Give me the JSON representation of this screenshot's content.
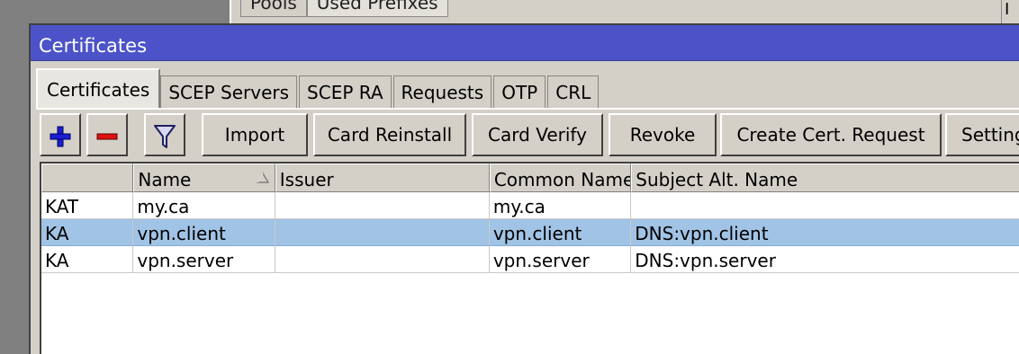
{
  "background_window": {
    "tabs": [
      "Pools",
      "Used Prefixes"
    ],
    "scroll_label": "I"
  },
  "window": {
    "title": "Certificates",
    "accent_color": "#4c53c8"
  },
  "tabs": [
    "Certificates",
    "SCEP Servers",
    "SCEP RA",
    "Requests",
    "OTP",
    "CRL"
  ],
  "toolbar": {
    "add_icon": "plus-icon",
    "remove_icon": "minus-icon",
    "filter_icon": "filter-icon",
    "buttons": [
      "Import",
      "Card Reinstall",
      "Card Verify",
      "Revoke",
      "Create Cert. Request",
      "Settings"
    ]
  },
  "table": {
    "columns": [
      "",
      "Name",
      "Issuer",
      "Common Name",
      "Subject Alt. Name"
    ],
    "rows": [
      {
        "flags": "KAT",
        "name": "my.ca",
        "issuer": "",
        "common_name": "my.ca",
        "subject_alt_name": ""
      },
      {
        "flags": "KA",
        "name": "vpn.client",
        "issuer": "",
        "common_name": "vpn.client",
        "subject_alt_name": "DNS:vpn.client"
      },
      {
        "flags": "KA",
        "name": "vpn.server",
        "issuer": "",
        "common_name": "vpn.server",
        "subject_alt_name": "DNS:vpn.server"
      }
    ],
    "selected_row_index": 1,
    "selected_row_color": "#a1c3e5"
  }
}
